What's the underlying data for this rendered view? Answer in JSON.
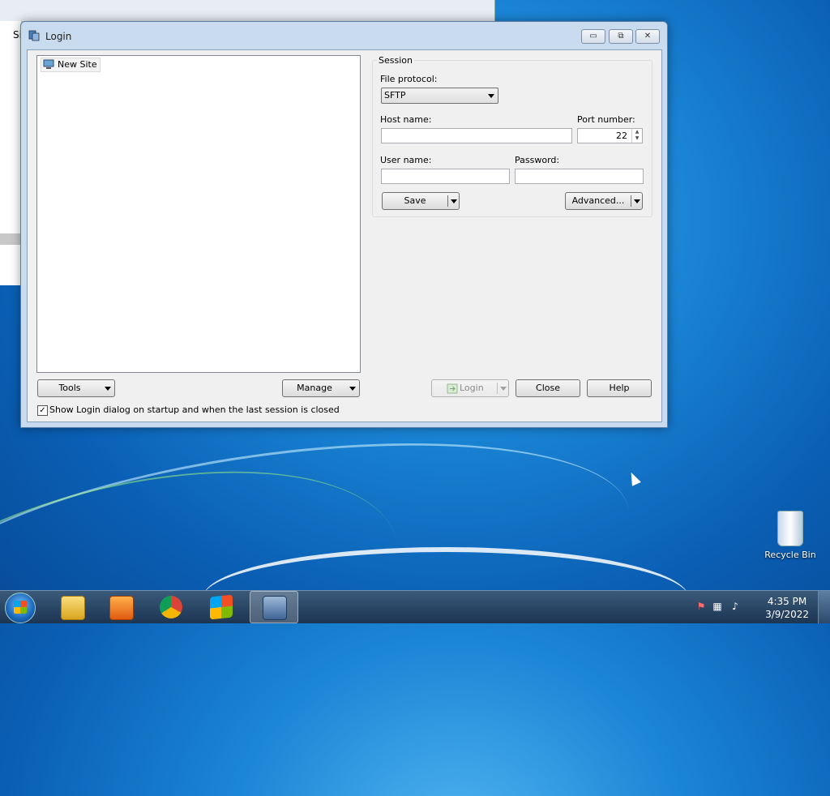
{
  "background_window": {
    "partial_text": "Si"
  },
  "dialog": {
    "title": "Login",
    "window_buttons": {
      "minimize": "▭",
      "restore": "⧉",
      "close": "✕"
    },
    "site_tree": {
      "items": [
        {
          "label": "New Site"
        }
      ]
    },
    "session": {
      "legend": "Session",
      "file_protocol_label": "File protocol:",
      "file_protocol_value": "SFTP",
      "host_label": "Host name:",
      "host_value": "",
      "port_label": "Port number:",
      "port_value": "22",
      "user_label": "User name:",
      "user_value": "",
      "password_label": "Password:",
      "password_value": "",
      "save_label": "Save",
      "advanced_label": "Advanced..."
    },
    "tools_label": "Tools",
    "manage_label": "Manage",
    "login_label": "Login",
    "close_label": "Close",
    "help_label": "Help",
    "show_login_checkbox_label": "Show Login dialog on startup and when the last session is closed",
    "show_login_checked": true
  },
  "desktop": {
    "recycle_bin_label": "Recycle Bin"
  },
  "taskbar": {
    "apps": [
      "windows-explorer-icon",
      "media-player-icon",
      "chrome-icon",
      "windows-flag-icon",
      "winscp-icon"
    ],
    "active_app": "winscp-icon",
    "clock_time": "4:35 PM",
    "clock_date": "3/9/2022"
  },
  "colors": {
    "desktop_blue": "#1b86d6",
    "taskbar": "#1c3553",
    "dialog_frame": "#c9dcef"
  }
}
